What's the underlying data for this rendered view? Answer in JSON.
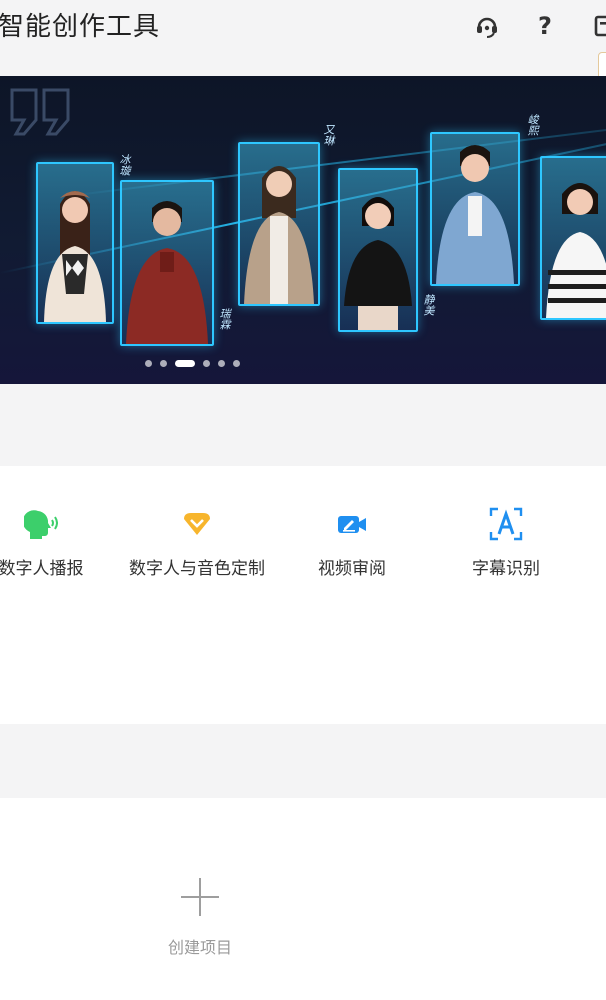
{
  "header": {
    "title": "智能创作工具",
    "icons": [
      "headset-icon",
      "help-icon",
      "menu-icon"
    ],
    "help_glyph": "?"
  },
  "banner": {
    "names": [
      "冰璇",
      "瑞霖",
      "又琳",
      "静美",
      "峻熙"
    ],
    "carousel": {
      "count": 6,
      "active_index": 2
    },
    "accent_color": "#2ec7ff"
  },
  "tools": [
    {
      "label": "数字人播报",
      "icon": "speaking-head-icon",
      "color": "#3ccf6b"
    },
    {
      "label": "数字人与音色定制",
      "icon": "heart-badge-icon",
      "color": "#f7b52c"
    },
    {
      "label": "视频审阅",
      "icon": "video-edit-icon",
      "color": "#1f8ff0"
    },
    {
      "label": "字幕识别",
      "icon": "text-scan-icon",
      "color": "#1f8ff0"
    }
  ],
  "projects": {
    "create_label": "创建项目"
  }
}
